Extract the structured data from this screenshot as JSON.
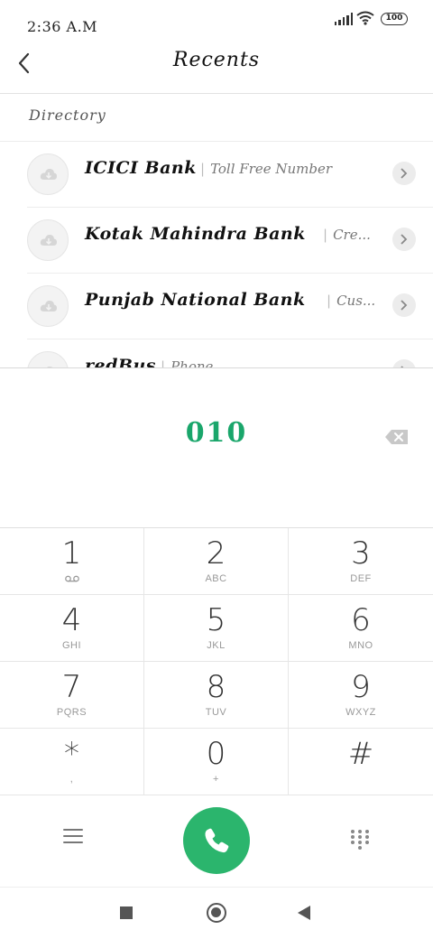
{
  "status_bar": {
    "time": "2:36 A.M",
    "battery": "100"
  },
  "header": {
    "title": "Recents"
  },
  "directory": {
    "title": "Directory",
    "items": [
      {
        "name": "ICICI Bank",
        "description": "Toll Free Number"
      },
      {
        "name": "Kotak Mahindra Bank",
        "description": "Cre..."
      },
      {
        "name": "Punjab National Bank",
        "description": "Cus..."
      },
      {
        "name": "redBus",
        "description": "Phone"
      }
    ]
  },
  "dialer": {
    "number": "010"
  },
  "keypad": [
    {
      "digit": "1",
      "letters": ""
    },
    {
      "digit": "2",
      "letters": "ABC"
    },
    {
      "digit": "3",
      "letters": "DEF"
    },
    {
      "digit": "4",
      "letters": "GHI"
    },
    {
      "digit": "5",
      "letters": "JKL"
    },
    {
      "digit": "6",
      "letters": "MNO"
    },
    {
      "digit": "7",
      "letters": "PQRS"
    },
    {
      "digit": "8",
      "letters": "TUV"
    },
    {
      "digit": "9",
      "letters": "WXYZ"
    },
    {
      "digit": "*",
      "letters": ","
    },
    {
      "digit": "0",
      "letters": "+"
    },
    {
      "digit": "#",
      "letters": ""
    }
  ],
  "icons": {
    "back": "arrow-left-icon",
    "backspace": "backspace-icon",
    "call": "phone-icon",
    "menu": "menu-icon",
    "dialpad": "dialpad-icon",
    "voicemail": "voicemail-icon"
  },
  "colors": {
    "accent": "#1aa66b",
    "call_button": "#2bb56d"
  }
}
